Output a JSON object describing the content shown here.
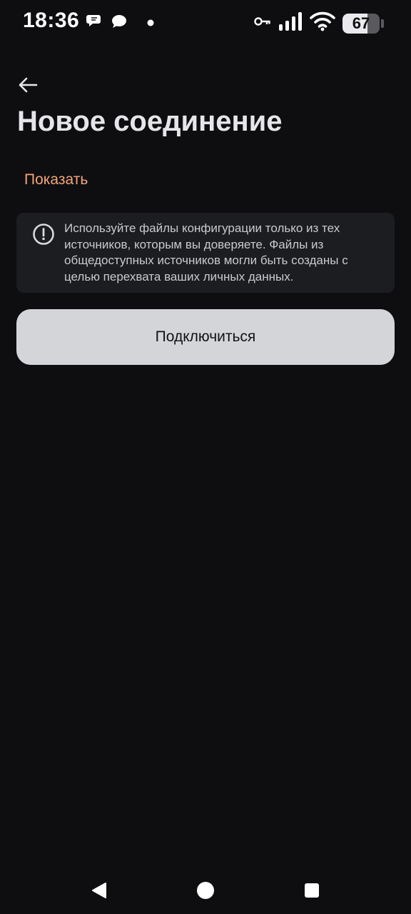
{
  "status_bar": {
    "time": "18:36",
    "battery_level": "67",
    "battery_fraction": 0.67,
    "icons": [
      "chat-bubbles-icon",
      "message-icon",
      "dot-icon",
      "vpn-key-icon",
      "signal-icon",
      "wifi-icon",
      "battery-icon"
    ]
  },
  "header": {
    "back_icon": "arrow-left-icon",
    "title": "Новое соединение"
  },
  "content": {
    "show_link": "Показать",
    "warning": {
      "icon": "exclamation-circle-icon",
      "text": "Используйте файлы конфигурации только из тех источников, которым вы доверяете. Файлы из общедоступных источников могли быть созданы с целью перехвата ваших личных данных."
    },
    "connect_button": "Подключиться"
  },
  "nav_bar": {
    "icons": [
      "back-triangle-icon",
      "home-circle-icon",
      "recents-square-icon"
    ]
  },
  "colors": {
    "background": "#0e0e10",
    "accent_link": "#f3a57a",
    "card": "#1c1d21",
    "button": "#d4d5d9"
  }
}
